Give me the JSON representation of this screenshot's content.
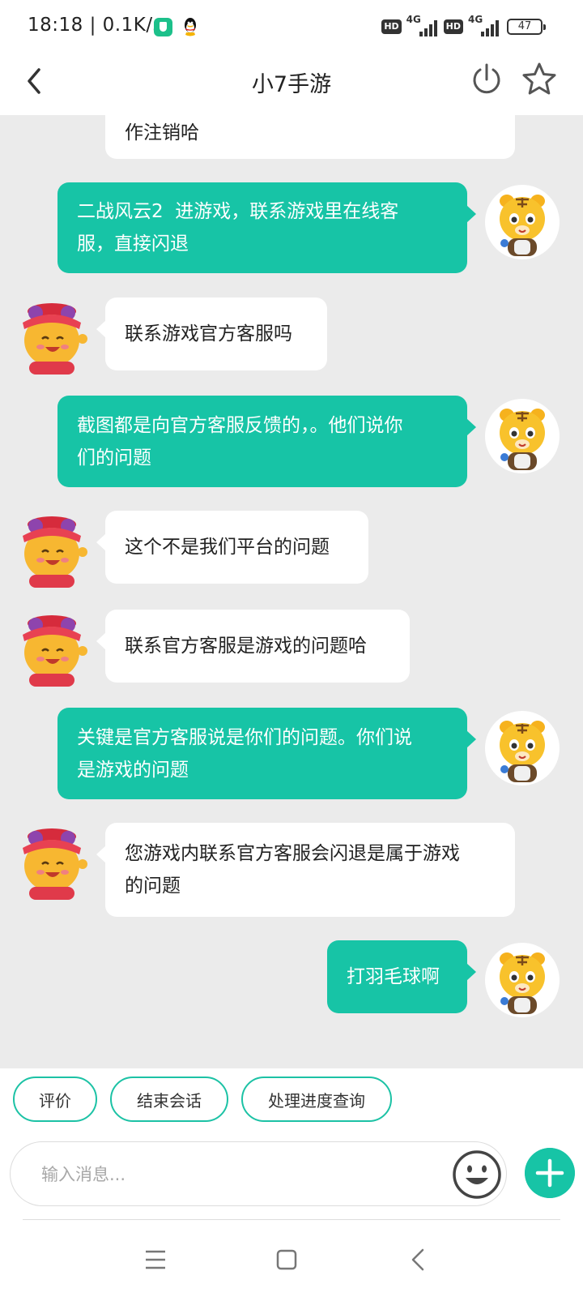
{
  "status_bar": {
    "time": "18:18 | 0.1K/s",
    "hd_label": "HD",
    "network_label": "4G",
    "battery": "47"
  },
  "header": {
    "title": "小7手游",
    "back_icon": "chevron-left-icon",
    "power_icon": "power-icon",
    "star_icon": "star-icon"
  },
  "messages": [
    {
      "sender": "agent",
      "lines": [
        "作注销哈"
      ]
    },
    {
      "sender": "user",
      "lines": [
        "二战风云2  进游戏，联系游戏里在线客",
        "服，直接闪退"
      ]
    },
    {
      "sender": "agent",
      "lines": [
        "联系游戏官方客服吗"
      ]
    },
    {
      "sender": "user",
      "lines": [
        "截图都是向官方客服反馈的，。他们说你",
        "们的问题"
      ]
    },
    {
      "sender": "agent",
      "lines": [
        "这个不是我们平台的问题"
      ]
    },
    {
      "sender": "agent",
      "lines": [
        "联系官方客服是游戏的问题哈"
      ]
    },
    {
      "sender": "user",
      "lines": [
        "关键是官方客服说是你们的问题。你们说",
        "是游戏的问题"
      ]
    },
    {
      "sender": "agent",
      "lines": [
        "您游戏内联系官方客服会闪退是属于游戏",
        "的问题"
      ]
    },
    {
      "sender": "user",
      "lines": [
        "打羽毛球啊"
      ]
    }
  ],
  "quick_actions": [
    "评价",
    "结束会话",
    "处理进度查询"
  ],
  "input": {
    "placeholder": "输入消息...",
    "value": ""
  },
  "nav": {
    "menu_icon": "menu-icon",
    "home_icon": "home-square-icon",
    "back_icon": "back-icon"
  },
  "colors": {
    "accent": "#17c4a6",
    "chat_bg": "#ebebeb",
    "agent_bubble": "#ffffff"
  }
}
